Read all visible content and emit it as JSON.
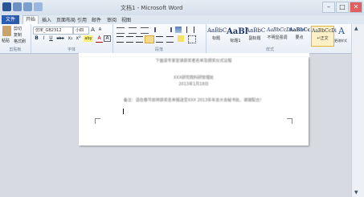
{
  "window": {
    "title": "文档1 - Microsoft Word",
    "min": "–",
    "max": "□",
    "close": "✕"
  },
  "tabs": [
    "文件",
    "开始",
    "插入",
    "页面布局",
    "引用",
    "邮件",
    "审阅",
    "视图"
  ],
  "ribbon": {
    "clipboard": {
      "paste": "粘贴",
      "cut": "剪切",
      "copy": "复制",
      "painter": "格式刷",
      "label": "剪贴板"
    },
    "font": {
      "name": "仿宋_GB2312",
      "size": "小四",
      "grow": "A",
      "shrink": "A",
      "bold": "B",
      "italic": "I",
      "underline": "U",
      "strike": "abe",
      "sub": "x₂",
      "sup": "x²",
      "highlight": "aby",
      "color": "A",
      "charborder": "A",
      "label": "字体"
    },
    "paragraph": {
      "label": "段落"
    },
    "styles": {
      "items": [
        {
          "preview": "AaBbC",
          "name": "标题"
        },
        {
          "preview": "AaBl",
          "name": "标题1"
        },
        {
          "preview": "AaBbC",
          "name": "副标题"
        },
        {
          "preview": "AaBbCcDi",
          "name": "不明显强调"
        },
        {
          "preview": "AaBbCcD",
          "name": "要点"
        },
        {
          "preview": "AaBbCcDi",
          "name": "↵正文"
        }
      ],
      "change": "更改样式",
      "label": "样式"
    }
  },
  "document": {
    "lines": [
      "下面请专家宣读获奖者名单及颁奖仪式议程",
      "XXX研究院科研管理处",
      "2013年1月18日",
      "备注：请在春节前将获奖名单报送至XXX 2013年年会大会秘书处，谢谢配合！"
    ]
  }
}
